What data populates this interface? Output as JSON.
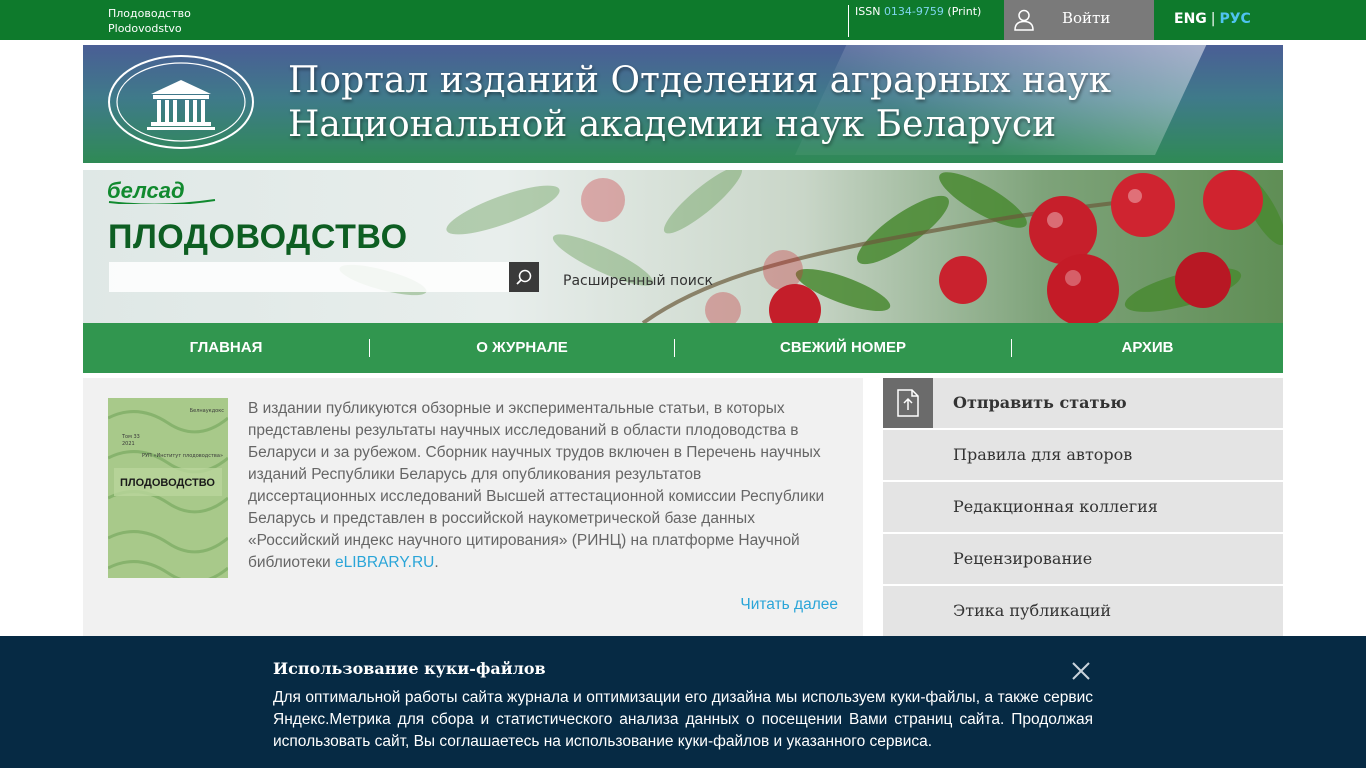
{
  "topbar": {
    "journal_name_ru": "Плодоводство",
    "journal_name_lat": "Plodovodstvo",
    "issn_label": "ISSN",
    "issn_number": "0134-9759",
    "issn_type": "(Print)",
    "login_label": "Войти",
    "lang_en": "ENG",
    "lang_sep": "|",
    "lang_ru": "РУС",
    "icon": "user-icon"
  },
  "portal": {
    "title_line1": "Портал изданий Отделения аграрных наук",
    "title_line2": "Национальной академии наук Беларуси",
    "emblem_icon": "academy-emblem"
  },
  "journal": {
    "brand_logo": "белсад",
    "title": "ПЛОДОВОДСТВО",
    "search_placeholder": "",
    "advanced_search": "Расширенный поиск"
  },
  "nav": {
    "items": [
      "ГЛАВНАЯ",
      "О ЖУРНАЛЕ",
      "СВЕЖИЙ НОМЕР",
      "АРХИВ"
    ]
  },
  "about": {
    "text": "В издании публикуются обзорные и экспериментальные статьи, в которых представлены результаты научных исследований в области плодоводства в Беларуси и за рубежом. Сборник научных трудов включен в Перечень научных изданий Республики Беларусь для опубликования результатов диссертационных исследований Высшей аттестационной комиссии Республики Беларусь и представлен в российской наукометрической базе данных «Российский индекс научного цитирования» (РИНЦ) на платформе Научной библиотеки ",
    "link_text": "eLIBRARY.RU",
    "text_end": ".",
    "read_more": "Читать далее",
    "cover": {
      "publisher": "Белнаукдокс",
      "volume_line1": "Том 33",
      "volume_line2": "2021",
      "institute": "РУП «Институт плодоводства»",
      "title": "ПЛОДОВОДСТВО",
      "color": "#a8c98a"
    }
  },
  "sidebar": {
    "items": [
      {
        "label": "Отправить статью",
        "icon": "submit-document-icon"
      },
      {
        "label": "Правила для авторов"
      },
      {
        "label": "Редакционная коллегия"
      },
      {
        "label": "Рецензирование"
      },
      {
        "label": "Этика публикаций"
      }
    ]
  },
  "cookie": {
    "title": "Использование куки-файлов",
    "text": "Для оптимальной работы сайта журнала и оптимизации его дизайна мы используем куки-файлы, а также сервис Яндекс.Метрика для сбора и статистического анализа данных о посещении Вами страниц сайта. Продолжая использовать сайт, Вы соглашаетесь на использование куки-файлов и указанного сервиса.",
    "close_icon": "close-icon"
  },
  "colors": {
    "topbar": "#0e7a2c",
    "nav": "#148737",
    "link": "#2aa5d8",
    "cookie_bg": "#062a44",
    "journal_title": "#0d5e22"
  }
}
